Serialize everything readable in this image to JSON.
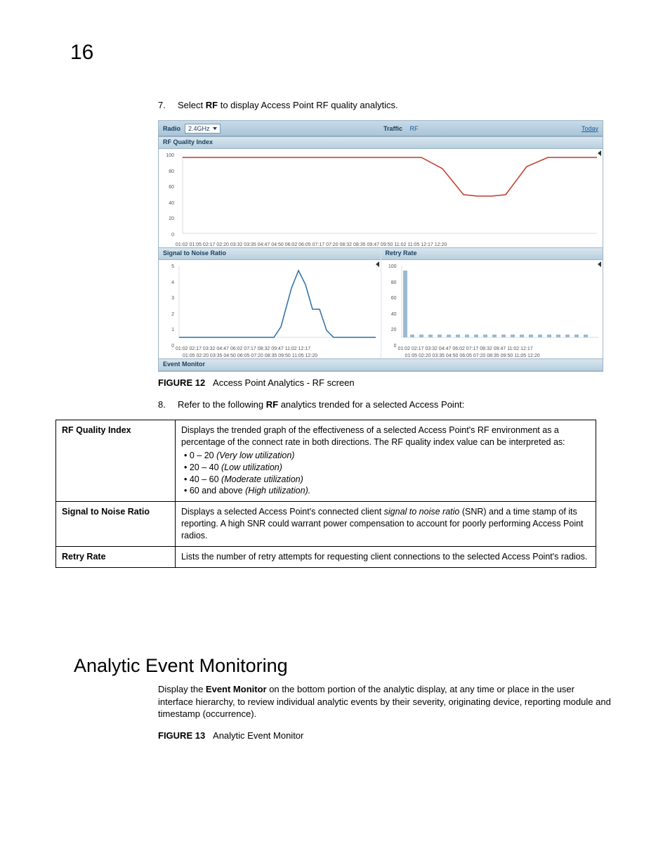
{
  "page_number": "16",
  "step7": {
    "num": "7.",
    "pre": "Select ",
    "bold": "RF",
    "post": " to display Access Point RF quality analytics."
  },
  "screenshot": {
    "radio_label": "Radio",
    "radio_value": "2.4GHz",
    "tab_traffic": "Traffic",
    "tab_rf": "RF",
    "today": "Today",
    "panel_rfqi": "RF Quality Index",
    "panel_snr": "Signal to Noise Ratio",
    "panel_retry": "Retry Rate",
    "panel_event": "Event Monitor",
    "x_row1": "01:02   01:05   02:17   02:20   03:32   03:35   04:47   04:50   06:02   06:05   07:17   07:20   08:32   08:35   09:47   09:50   11:02   11:05   12:17   12:20",
    "x_snr_r1": "01:02   02:17   03:32   04:47   06:02   07:17   08:32   09:47   11:02   12:17",
    "x_snr_r2": "01:05   02:20   03:35   04:50   06:05   07:20   08:35   09:50   11:05   12:20",
    "x_retry_r1": "01:02  02:17  03:32  04:47  06:02  07:17  08:32  09:47  11:02  12:17",
    "x_retry_r2": "01:05  02:20  03:35  04:50  06:05  07:20  08:35  09:50  11:05  12:20"
  },
  "fig12": {
    "label": "FIGURE 12",
    "caption": "Access Point Analytics - RF screen"
  },
  "step8": {
    "num": "8.",
    "pre": "Refer to the following ",
    "bold": "RF",
    "post": " analytics trended for a selected Access Point:"
  },
  "defs": {
    "rfqi": {
      "term": "RF Quality Index",
      "body": "Displays the trended graph of the effectiveness of a selected Access Point's RF environment as a percentage of the connect rate in both directions. The RF quality index value can be interpreted as:",
      "b1a": "0 – 20 ",
      "b1b": "(Very low utilization)",
      "b2a": "20 – 40 ",
      "b2b": "(Low utilization)",
      "b3a": "40 – 60 ",
      "b3b": "(Moderate utilization)",
      "b4a": "60 and above ",
      "b4b": "(High utilization)."
    },
    "snr": {
      "term": "Signal to Noise Ratio",
      "pre": "Displays a selected Access Point's connected client ",
      "it": "signal to noise ratio",
      "post": " (SNR) and a time stamp of its reporting. A high SNR could warrant power compensation to account for poorly performing Access Point radios."
    },
    "retry": {
      "term": "Retry Rate",
      "body": "Lists the number of retry attempts for requesting client connections to the selected Access Point's radios."
    }
  },
  "heading": "Analytic Event Monitoring",
  "para_pre": "Display the ",
  "para_bold": "Event Monitor",
  "para_post": " on the bottom portion of the analytic display, at any time or place in the user interface hierarchy, to review individual analytic events by their severity, originating device, reporting module and timestamp (occurrence).",
  "fig13": {
    "label": "FIGURE 13",
    "caption": "Analytic Event Monitor"
  },
  "chart_data": [
    {
      "type": "line",
      "title": "RF Quality Index",
      "ylim": [
        0,
        100
      ],
      "y_ticks": [
        0,
        20,
        40,
        60,
        80,
        100
      ],
      "x": [
        "01:02",
        "01:05",
        "02:17",
        "02:20",
        "03:32",
        "03:35",
        "04:47",
        "04:50",
        "06:02",
        "06:05",
        "07:17",
        "07:20",
        "08:32",
        "08:35",
        "09:47",
        "09:50",
        "11:02",
        "11:05",
        "12:17",
        "12:20"
      ],
      "series": [
        {
          "name": "RF Quality",
          "color": "#c0392b",
          "values": [
            100,
            100,
            100,
            100,
            100,
            100,
            100,
            100,
            100,
            100,
            100,
            100,
            80,
            58,
            58,
            58,
            60,
            90,
            100,
            100
          ]
        }
      ]
    },
    {
      "type": "line",
      "title": "Signal to Noise Ratio",
      "ylim": [
        0,
        5
      ],
      "y_ticks": [
        0,
        1,
        2,
        3,
        4,
        5
      ],
      "x": [
        "01:02",
        "01:05",
        "02:17",
        "02:20",
        "03:32",
        "03:35",
        "04:47",
        "04:50",
        "06:02",
        "06:05",
        "07:17",
        "07:20",
        "08:32",
        "08:35",
        "09:47",
        "09:50",
        "11:02",
        "11:05",
        "12:17",
        "12:20"
      ],
      "series": [
        {
          "name": "SNR",
          "color": "#2e6da4",
          "values": [
            0,
            0,
            0,
            0,
            0,
            0,
            0,
            0,
            0,
            0,
            1,
            4,
            5,
            4,
            2,
            2,
            0.5,
            0,
            0,
            0
          ]
        }
      ]
    },
    {
      "type": "bar",
      "title": "Retry Rate",
      "ylim": [
        0,
        100
      ],
      "y_ticks": [
        0,
        20,
        40,
        60,
        80,
        100
      ],
      "x": [
        "01:02",
        "01:05",
        "02:17",
        "02:20",
        "03:32",
        "03:35",
        "04:47",
        "04:50",
        "06:02",
        "06:05",
        "07:17",
        "07:20",
        "08:32",
        "08:35",
        "09:47",
        "09:50",
        "11:02",
        "11:05",
        "12:17",
        "12:20"
      ],
      "series": [
        {
          "name": "Retry",
          "color": "#9cbad1",
          "values": [
            90,
            2,
            2,
            2,
            2,
            2,
            2,
            2,
            2,
            2,
            2,
            2,
            2,
            2,
            2,
            2,
            2,
            2,
            2,
            2
          ]
        }
      ]
    }
  ]
}
